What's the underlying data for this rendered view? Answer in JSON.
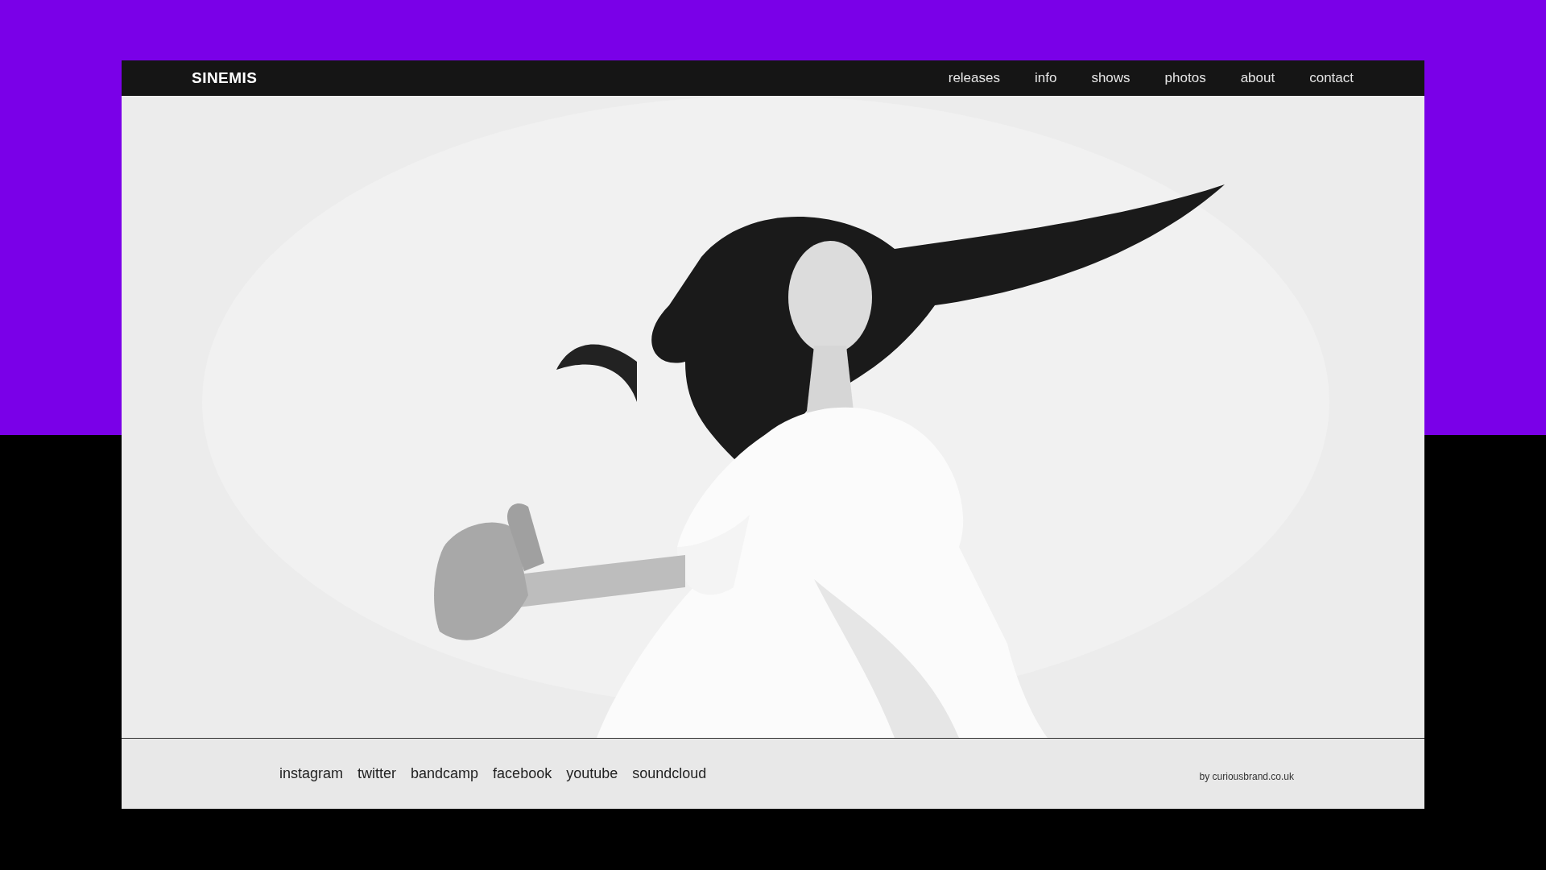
{
  "site": {
    "logo": "SINEMIS"
  },
  "nav": [
    {
      "label": "releases"
    },
    {
      "label": "info"
    },
    {
      "label": "shows"
    },
    {
      "label": "photos"
    },
    {
      "label": "about"
    },
    {
      "label": "contact"
    }
  ],
  "footer": {
    "links": [
      "instagram",
      "twitter",
      "bandcamp",
      "facebook",
      "youtube",
      "soundcloud"
    ],
    "credit": "by curiousbrand.co.uk"
  }
}
